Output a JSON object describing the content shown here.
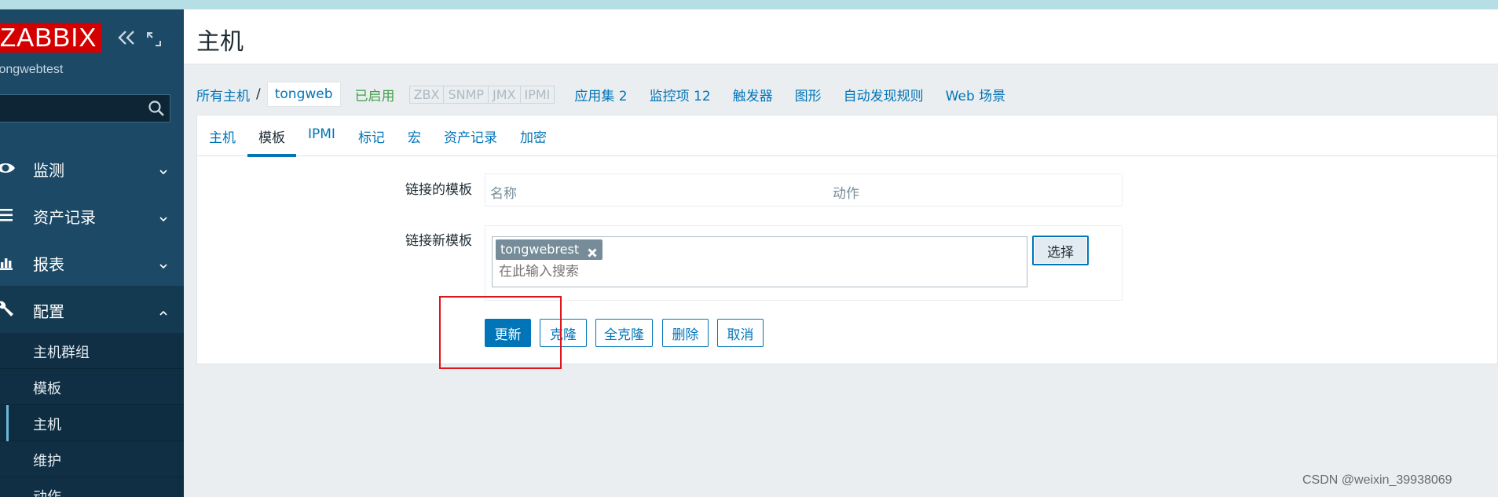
{
  "sidebar": {
    "logo": "ZABBIX",
    "server_name": "tongwebtest",
    "menu": [
      {
        "label": "监测",
        "icon": "eye-icon",
        "expanded": false
      },
      {
        "label": "资产记录",
        "icon": "list-icon",
        "expanded": false
      },
      {
        "label": "报表",
        "icon": "bar-chart-icon",
        "expanded": false
      },
      {
        "label": "配置",
        "icon": "wrench-icon",
        "expanded": true
      }
    ],
    "submenu": [
      "主机群组",
      "模板",
      "主机",
      "维护",
      "动作"
    ],
    "submenu_selected": "主机"
  },
  "header": {
    "title": "主机"
  },
  "breadcrumb": {
    "all_hosts": "所有主机",
    "separator": "/",
    "current_host": "tongweb",
    "status": "已启用",
    "availability": [
      "ZBX",
      "SNMP",
      "JMX",
      "IPMI"
    ],
    "links": [
      "应用集 2",
      "监控项 12",
      "触发器",
      "图形",
      "自动发现规则",
      "Web 场景"
    ]
  },
  "tabs": [
    "主机",
    "模板",
    "IPMI",
    "标记",
    "宏",
    "资产记录",
    "加密"
  ],
  "active_tab": "模板",
  "form": {
    "linked_templates_label": "链接的模板",
    "linked_table_headers": {
      "name": "名称",
      "action": "动作"
    },
    "link_new_label": "链接新模板",
    "selected_template": "tongwebrest",
    "search_placeholder": "在此输入搜索",
    "select_button": "选择"
  },
  "buttons": {
    "update": "更新",
    "clone": "克隆",
    "full_clone": "全克隆",
    "delete": "删除",
    "cancel": "取消"
  },
  "watermark": "CSDN @weixin_39938069",
  "colors": {
    "sidebar_bg": "#1c4966",
    "logo_red": "#d40000",
    "link_blue": "#0275b8",
    "status_green": "#429e47",
    "highlight_red": "#e0141b"
  }
}
